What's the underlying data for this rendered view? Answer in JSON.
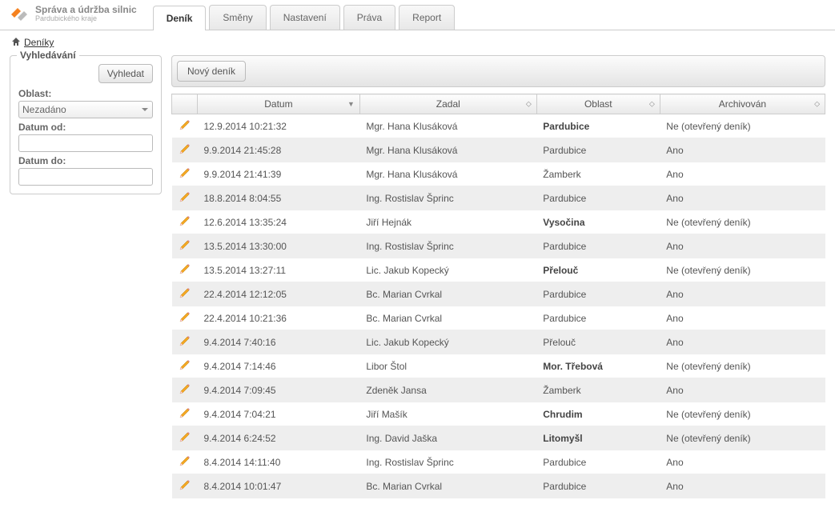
{
  "logo": {
    "line1": "Správa a údržba silnic",
    "line2": "Pardubického kraje"
  },
  "tabs": [
    {
      "label": "Deník",
      "active": true
    },
    {
      "label": "Směny",
      "active": false
    },
    {
      "label": "Nastavení",
      "active": false
    },
    {
      "label": "Práva",
      "active": false
    },
    {
      "label": "Report",
      "active": false
    }
  ],
  "breadcrumb": {
    "label": "Deníky"
  },
  "search": {
    "title": "Vyhledávání",
    "button": "Vyhledat",
    "oblast_label": "Oblast:",
    "oblast_value": "Nezadáno",
    "datum_od_label": "Datum od:",
    "datum_od_value": "",
    "datum_do_label": "Datum do:",
    "datum_do_value": ""
  },
  "toolbar": {
    "new_button": "Nový deník"
  },
  "columns": {
    "datum": "Datum",
    "zadal": "Zadal",
    "oblast": "Oblast",
    "archivovan": "Archivován"
  },
  "rows": [
    {
      "datum": "12.9.2014 10:21:32",
      "zadal": "Mgr. Hana Klusáková",
      "oblast": "Pardubice",
      "oblast_bold": true,
      "archivovan": "Ne (otevřený deník)"
    },
    {
      "datum": "9.9.2014 21:45:28",
      "zadal": "Mgr. Hana Klusáková",
      "oblast": "Pardubice",
      "oblast_bold": false,
      "archivovan": "Ano"
    },
    {
      "datum": "9.9.2014 21:41:39",
      "zadal": "Mgr. Hana Klusáková",
      "oblast": "Žamberk",
      "oblast_bold": false,
      "archivovan": "Ano"
    },
    {
      "datum": "18.8.2014 8:04:55",
      "zadal": "Ing. Rostislav Šprinc",
      "oblast": "Pardubice",
      "oblast_bold": false,
      "archivovan": "Ano"
    },
    {
      "datum": "12.6.2014 13:35:24",
      "zadal": "Jiří Hejnák",
      "oblast": "Vysočina",
      "oblast_bold": true,
      "archivovan": "Ne (otevřený deník)"
    },
    {
      "datum": "13.5.2014 13:30:00",
      "zadal": "Ing. Rostislav Šprinc",
      "oblast": "Pardubice",
      "oblast_bold": false,
      "archivovan": "Ano"
    },
    {
      "datum": "13.5.2014 13:27:11",
      "zadal": "Lic. Jakub Kopecký",
      "oblast": "Přelouč",
      "oblast_bold": true,
      "archivovan": "Ne (otevřený deník)"
    },
    {
      "datum": "22.4.2014 12:12:05",
      "zadal": "Bc. Marian Cvrkal",
      "oblast": "Pardubice",
      "oblast_bold": false,
      "archivovan": "Ano"
    },
    {
      "datum": "22.4.2014 10:21:36",
      "zadal": "Bc. Marian Cvrkal",
      "oblast": "Pardubice",
      "oblast_bold": false,
      "archivovan": "Ano"
    },
    {
      "datum": "9.4.2014 7:40:16",
      "zadal": "Lic. Jakub Kopecký",
      "oblast": "Přelouč",
      "oblast_bold": false,
      "archivovan": "Ano"
    },
    {
      "datum": "9.4.2014 7:14:46",
      "zadal": "Libor Štol",
      "oblast": "Mor. Třebová",
      "oblast_bold": true,
      "archivovan": "Ne (otevřený deník)"
    },
    {
      "datum": "9.4.2014 7:09:45",
      "zadal": "Zdeněk Jansa",
      "oblast": "Žamberk",
      "oblast_bold": false,
      "archivovan": "Ano"
    },
    {
      "datum": "9.4.2014 7:04:21",
      "zadal": "Jiří Mašík",
      "oblast": "Chrudim",
      "oblast_bold": true,
      "archivovan": "Ne (otevřený deník)"
    },
    {
      "datum": "9.4.2014 6:24:52",
      "zadal": "Ing. David Jaška",
      "oblast": "Litomyšl",
      "oblast_bold": true,
      "archivovan": "Ne (otevřený deník)"
    },
    {
      "datum": "8.4.2014 14:11:40",
      "zadal": "Ing. Rostislav Šprinc",
      "oblast": "Pardubice",
      "oblast_bold": false,
      "archivovan": "Ano"
    },
    {
      "datum": "8.4.2014 10:01:47",
      "zadal": "Bc. Marian Cvrkal",
      "oblast": "Pardubice",
      "oblast_bold": false,
      "archivovan": "Ano"
    }
  ]
}
